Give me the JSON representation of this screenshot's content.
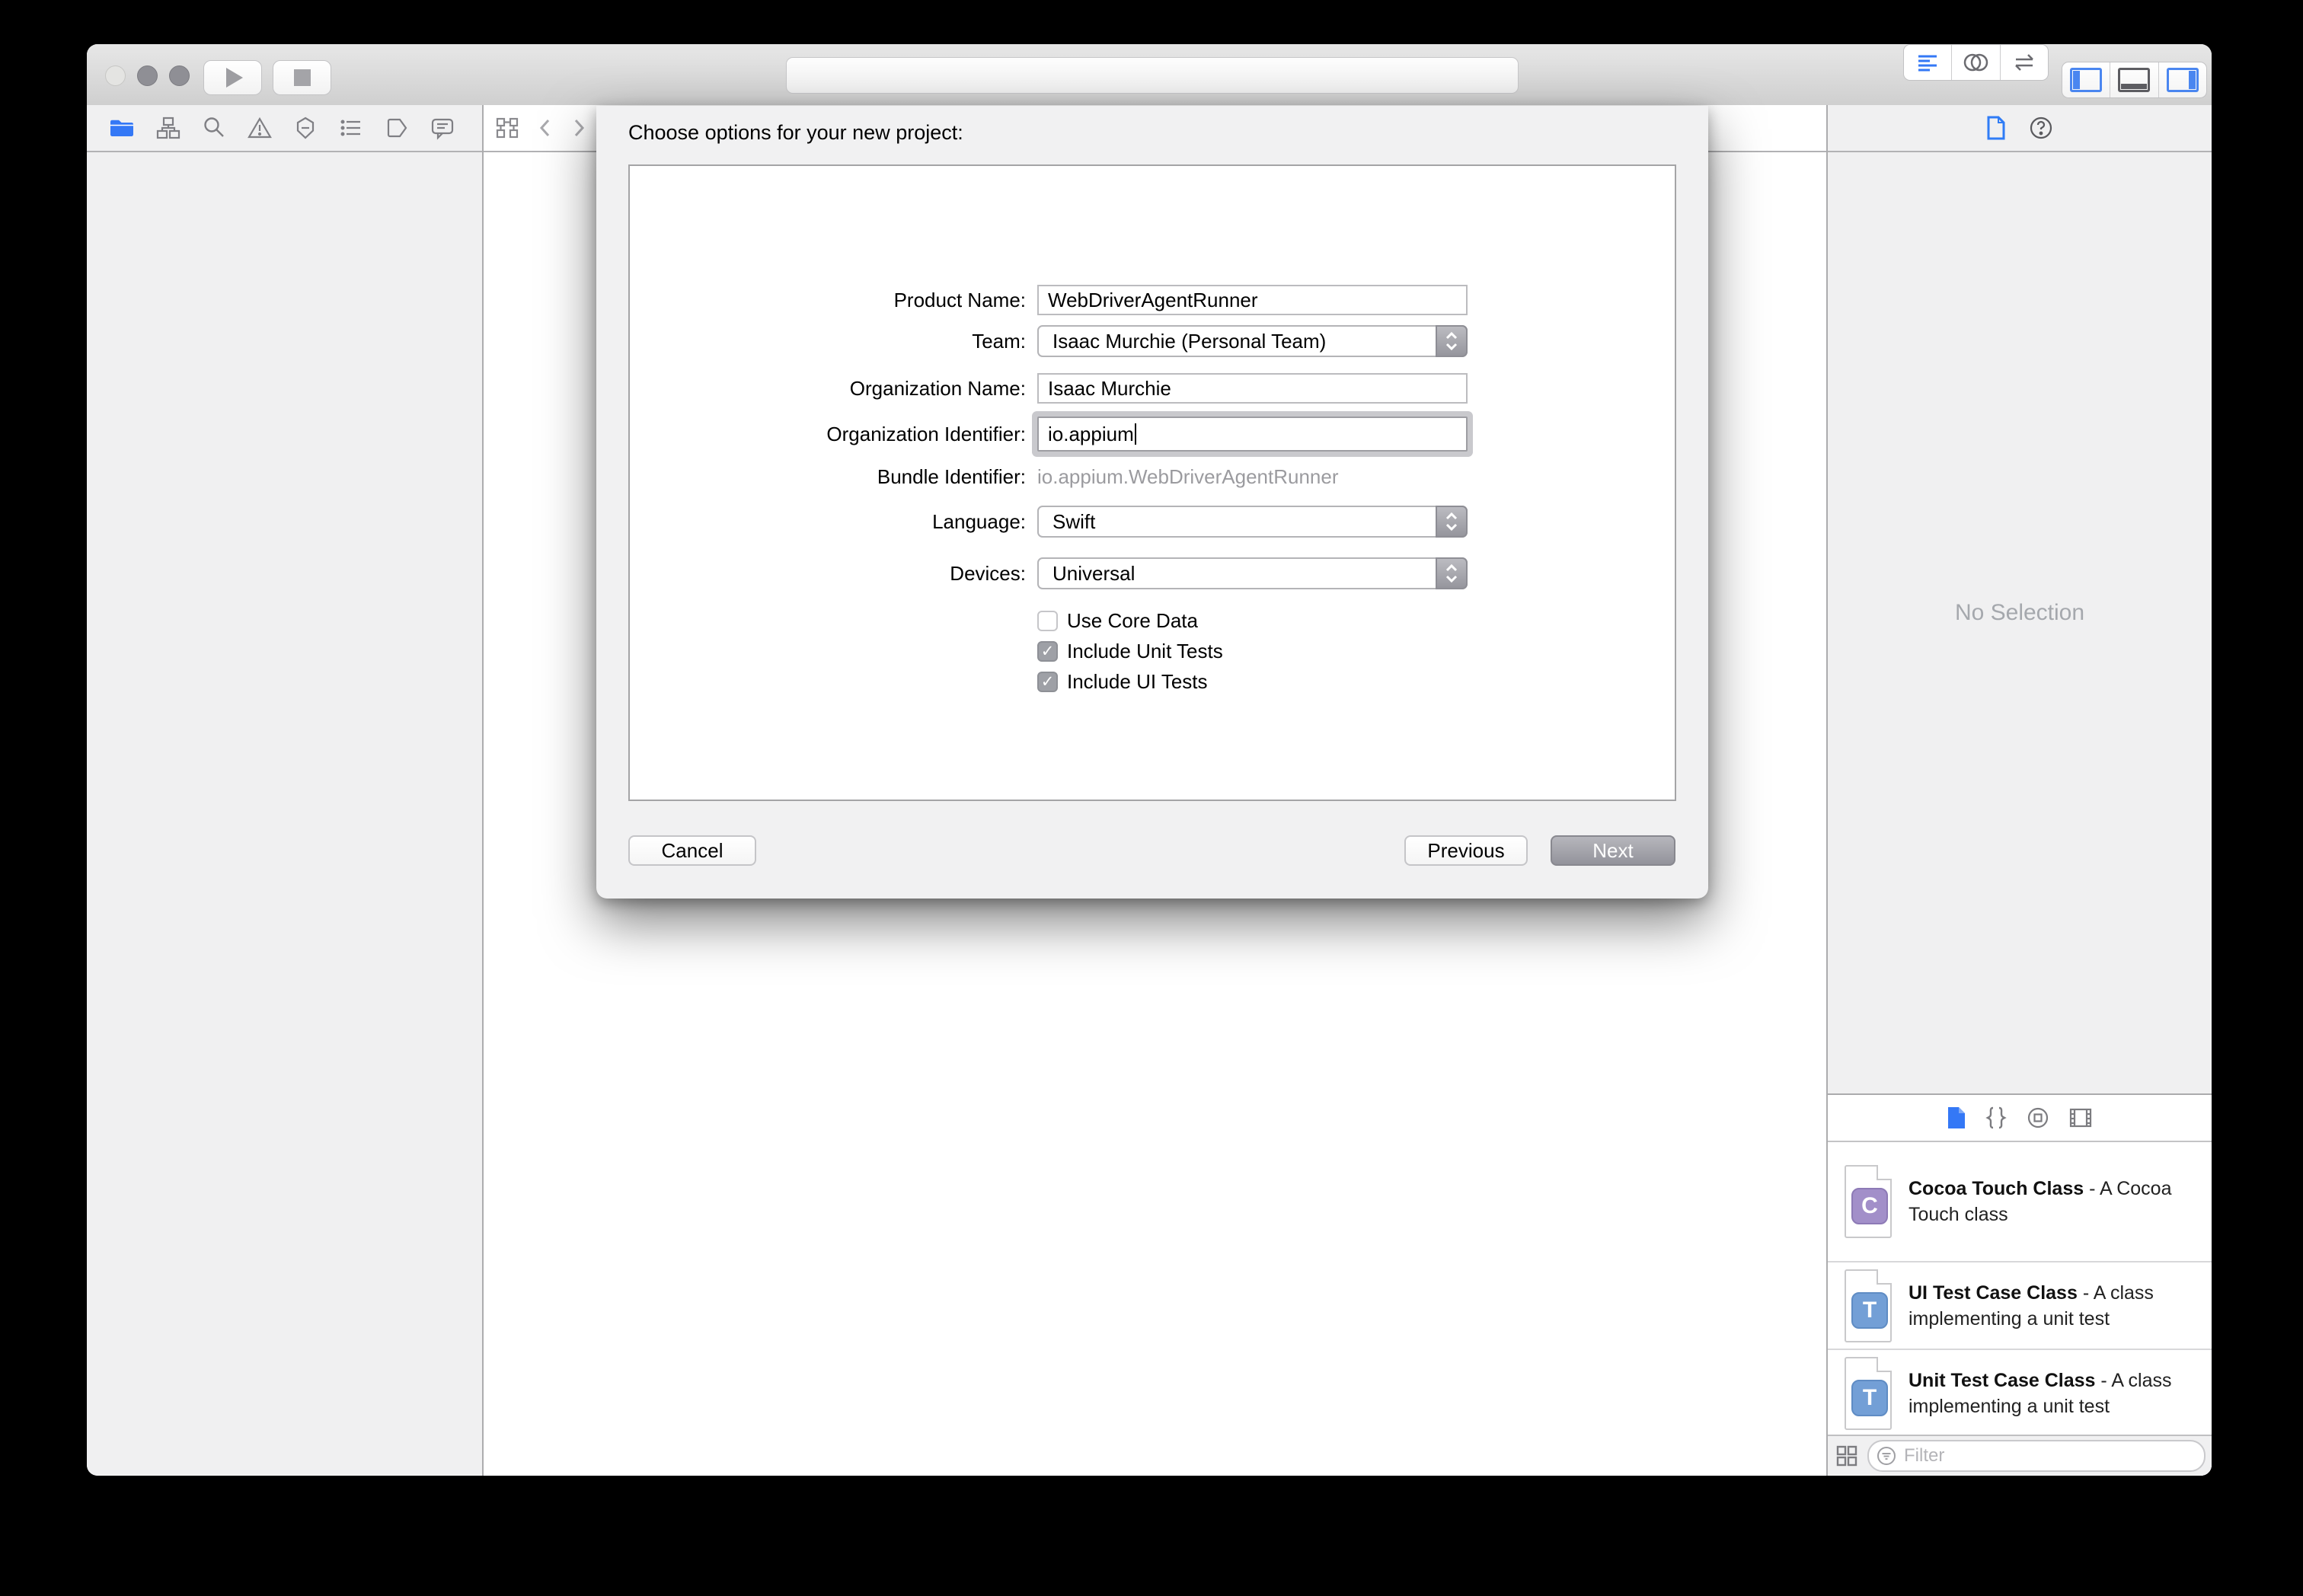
{
  "dialog": {
    "title": "Choose options for your new project:",
    "fields": {
      "product_name": {
        "label": "Product Name:",
        "value": "WebDriverAgentRunner"
      },
      "team": {
        "label": "Team:",
        "value": "Isaac Murchie (Personal Team)"
      },
      "organization_name": {
        "label": "Organization Name:",
        "value": "Isaac Murchie"
      },
      "organization_identifier": {
        "label": "Organization Identifier:",
        "value": "io.appium"
      },
      "bundle_identifier": {
        "label": "Bundle Identifier:",
        "value": "io.appium.WebDriverAgentRunner"
      },
      "language": {
        "label": "Language:",
        "value": "Swift"
      },
      "devices": {
        "label": "Devices:",
        "value": "Universal"
      }
    },
    "checkboxes": [
      {
        "label": "Use Core Data",
        "checked": false
      },
      {
        "label": "Include Unit Tests",
        "checked": true
      },
      {
        "label": "Include UI Tests",
        "checked": true
      }
    ],
    "buttons": {
      "cancel": "Cancel",
      "previous": "Previous",
      "next": "Next"
    }
  },
  "utilities": {
    "no_selection": "No Selection",
    "library": {
      "separator": " - ",
      "items": [
        {
          "title": "Cocoa Touch Class",
          "desc": "A Cocoa Touch class",
          "badge": "C",
          "badge_color": "#a violet",
          "badge_bg": "#a28fc9",
          "badge_border": "#8d7ab6"
        },
        {
          "title": "UI Test Case Class",
          "desc": "A class implementing a unit test",
          "badge": "T",
          "badge_bg": "#739fd6",
          "badge_border": "#5f8cc4"
        },
        {
          "title": "Unit Test Case Class",
          "desc": "A class implementing a unit test",
          "badge": "T",
          "badge_bg": "#739fd6",
          "badge_border": "#5f8cc4"
        }
      ],
      "filter_placeholder": "Filter"
    }
  },
  "colors": {
    "accent_blue": "#3478f6",
    "gray_icon": "#7f7f84",
    "next_button_gray": "#9b9ba2"
  }
}
